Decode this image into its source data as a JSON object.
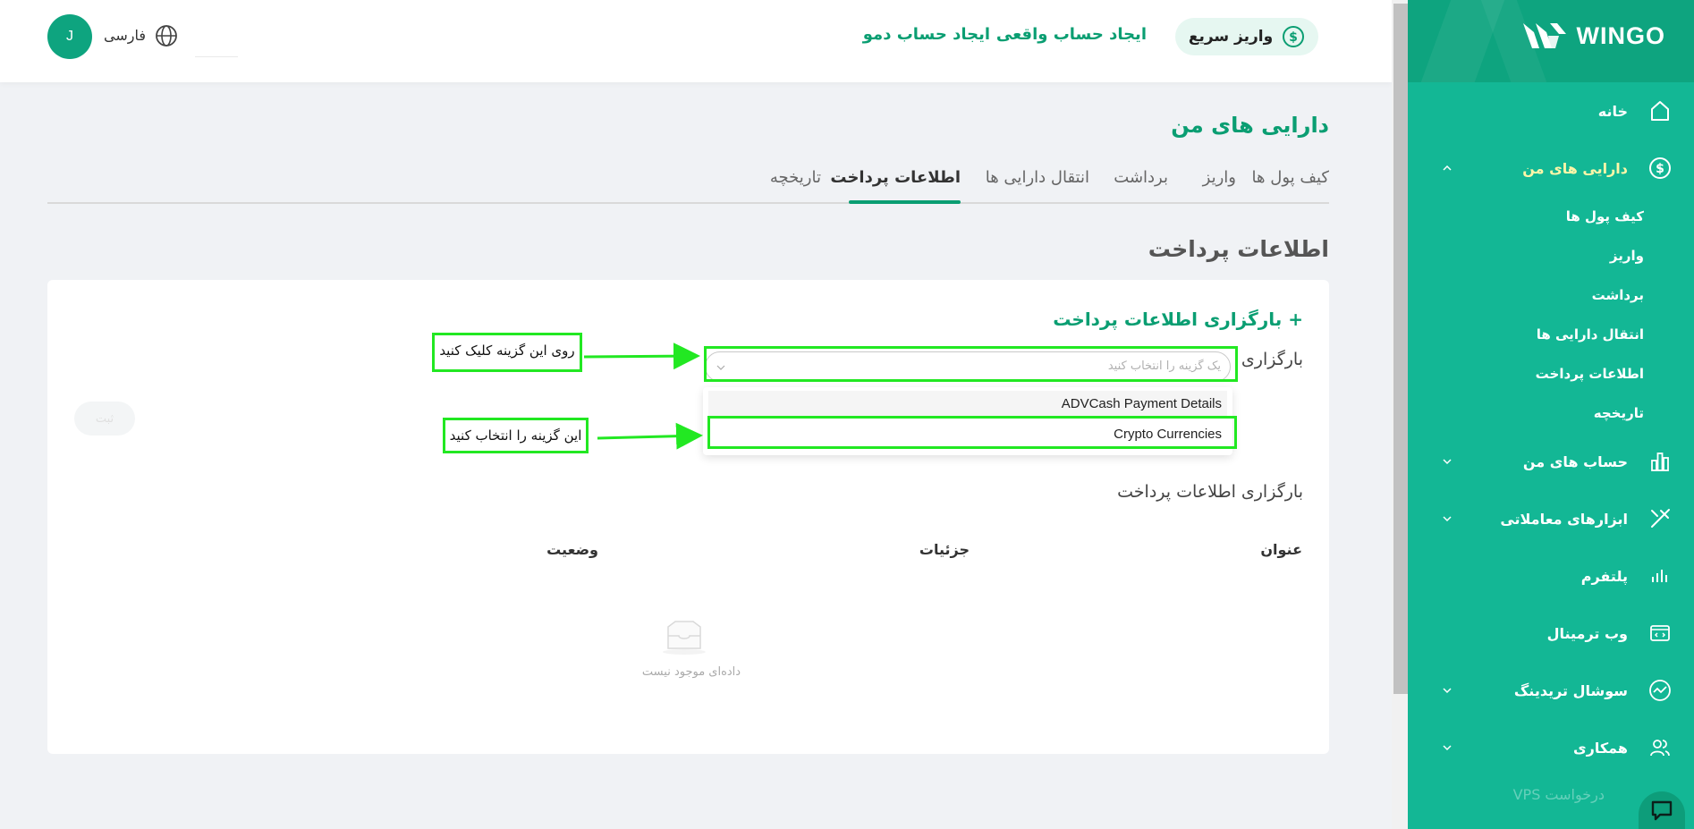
{
  "brand": {
    "name": "WINGO"
  },
  "topbar": {
    "quick_deposit": "واریز سریع",
    "open_real": "ایجاد حساب واقعی",
    "open_demo": "ایجاد حساب دمو",
    "language": "فارسی",
    "avatar_initial": "J"
  },
  "sidebar": {
    "home": "خانه",
    "my_assets": "دارایی های من",
    "sub_items": [
      "کیف پول ها",
      "واریز",
      "برداشت",
      "انتقال دارایی ها",
      "اطلاعات پرداخت",
      "تاریخچه"
    ],
    "my_accounts": "حساب های من",
    "trading_tools": "ابزارهای معاملاتی",
    "platform": "پلتفرم",
    "web_terminal": "وب ترمینال",
    "social_trading": "سوشال تریدینگ",
    "partnership": "همکاری",
    "vps_request": "درخواست VPS"
  },
  "page": {
    "title": "دارایی های من",
    "tabs": [
      "کیف پول ها",
      "واریز",
      "برداشت",
      "انتقال دارایی ها",
      "اطلاعات پرداخت",
      "تاریخچه"
    ],
    "active_tab": "اطلاعات پرداخت",
    "section_title": "اطلاعات پرداخت"
  },
  "card": {
    "add_link": "+ بارگزاری اطلاعات پرداخت",
    "upload_label": "بارگزاری",
    "select_placeholder": "یک گزینه را انتخاب کنید",
    "options": [
      "ADVCash Payment Details",
      "Crypto Currencies"
    ],
    "submit_label": "ثبت",
    "table_title": "بارگزاری اطلاعات پرداخت",
    "columns": [
      "عنوان",
      "جزئیات",
      "وضعیت"
    ],
    "empty_text": "داده‌ای موجود نیست"
  },
  "annotations": {
    "click_hint": "روی این گزینه کلیک کنید",
    "select_hint": "این گزینه را انتخاب کنید",
    "highlight_color": "#22e822"
  },
  "colors": {
    "accent": "#0a9e72",
    "sidebar": "#13b795",
    "active_menu": "#fff6a8"
  }
}
